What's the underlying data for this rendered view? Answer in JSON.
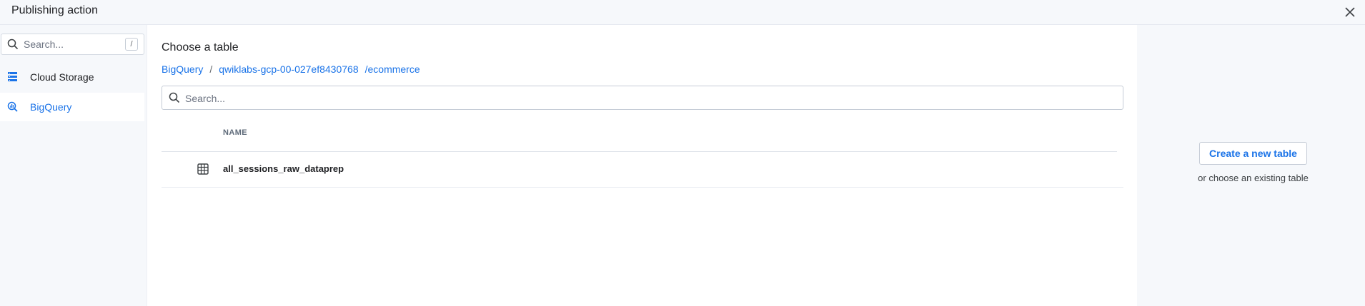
{
  "dialog": {
    "title": "Publishing action"
  },
  "sidebar": {
    "search": {
      "placeholder": "Search...",
      "shortcut": "/"
    },
    "items": [
      {
        "label": "Cloud Storage",
        "icon": "storage-icon"
      },
      {
        "label": "BigQuery",
        "icon": "bigquery-icon",
        "selected": true
      }
    ]
  },
  "main": {
    "title": "Choose a table",
    "breadcrumb": {
      "items": [
        "BigQuery",
        "qwiklabs-gcp-00-027ef8430768",
        "/ecommerce"
      ],
      "separator": "/"
    },
    "search": {
      "placeholder": "Search..."
    },
    "table": {
      "columns": [
        "NAME"
      ],
      "rows": [
        {
          "name": "all_sessions_raw_dataprep",
          "icon": "table-icon"
        }
      ]
    }
  },
  "right_panel": {
    "create_label": "Create a new table",
    "or_text": "or choose an existing table"
  },
  "colors": {
    "accent": "#1a73e8",
    "panel_bg": "#f6f8fb",
    "border": "#c5ccd6"
  }
}
